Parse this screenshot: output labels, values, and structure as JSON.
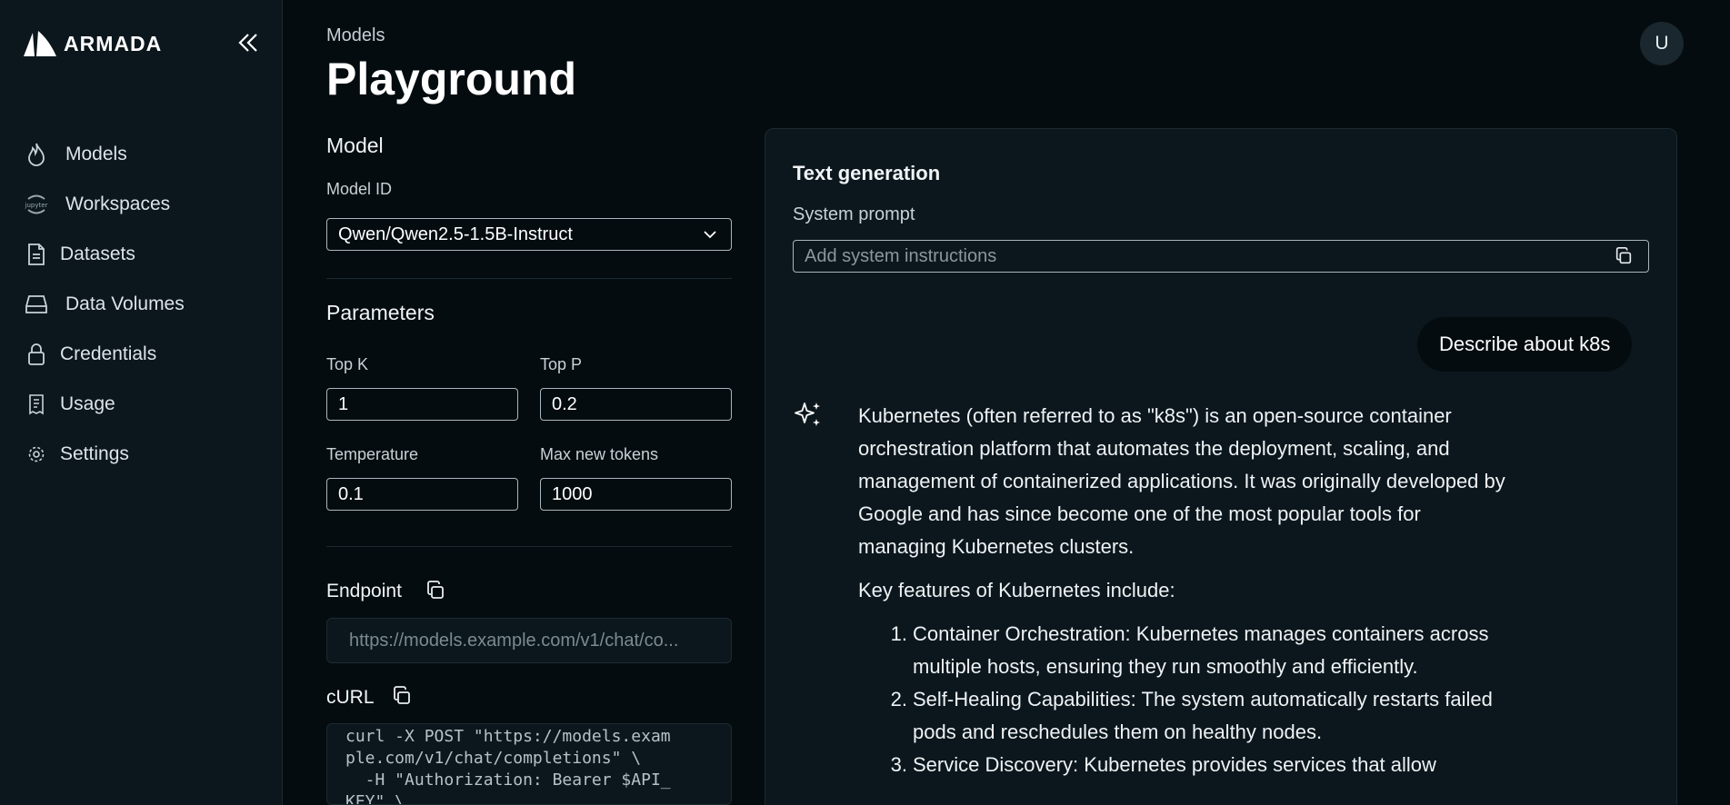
{
  "app": {
    "logo_text": "ARMADA",
    "avatar_initial": "U"
  },
  "sidebar": {
    "items": [
      {
        "label": "Models",
        "icon": "flame-icon"
      },
      {
        "label": "Workspaces",
        "icon": "jupyter-icon"
      },
      {
        "label": "Datasets",
        "icon": "document-icon"
      },
      {
        "label": "Data Volumes",
        "icon": "drive-icon"
      },
      {
        "label": "Credentials",
        "icon": "lock-icon"
      },
      {
        "label": "Usage",
        "icon": "receipt-icon"
      },
      {
        "label": "Settings",
        "icon": "gear-icon"
      }
    ]
  },
  "header": {
    "breadcrumb": "Models",
    "title": "Playground"
  },
  "model": {
    "section_title": "Model",
    "model_id_label": "Model ID",
    "model_id_value": "Qwen/Qwen2.5-1.5B-Instruct"
  },
  "parameters": {
    "section_title": "Parameters",
    "top_k_label": "Top K",
    "top_k": "1",
    "top_p_label": "Top P",
    "top_p": "0.2",
    "temperature_label": "Temperature",
    "temperature": "0.1",
    "max_tokens_label": "Max new tokens",
    "max_tokens": "1000"
  },
  "endpoint": {
    "label": "Endpoint",
    "value": "https://models.example.com/v1/chat/co..."
  },
  "curl": {
    "label": "cURL",
    "code": "curl -X POST \"https://models.exam\nple.com/v1/chat/completions\" \\\n  -H \"Authorization: Bearer $API_\nKEY\" \\"
  },
  "chat": {
    "title": "Text generation",
    "system_prompt_label": "System prompt",
    "system_prompt_placeholder": "Add system instructions",
    "user_message": "Describe about k8s",
    "assistant_intro": "Kubernetes (often referred to as \"k8s\") is an open-source container orchestration platform that automates the deployment, scaling, and management of containerized applications. It was originally developed by Google and has since become one of the most popular tools for managing Kubernetes clusters.",
    "assistant_features_heading": "Key features of Kubernetes include:",
    "assistant_list": [
      {
        "num": "1.",
        "text": "Container Orchestration: Kubernetes manages containers across multiple hosts, ensuring they run smoothly and efficiently."
      },
      {
        "num": "2.",
        "text": "Self-Healing Capabilities: The system automatically restarts failed pods and reschedules them on healthy nodes."
      },
      {
        "num": "3.",
        "text": "Service Discovery: Kubernetes provides services that allow"
      }
    ]
  },
  "colors": {
    "background": "#040c10",
    "sidebar": "#0b171d",
    "border": "#1d2a31",
    "input_border": "#a9b6bd"
  }
}
